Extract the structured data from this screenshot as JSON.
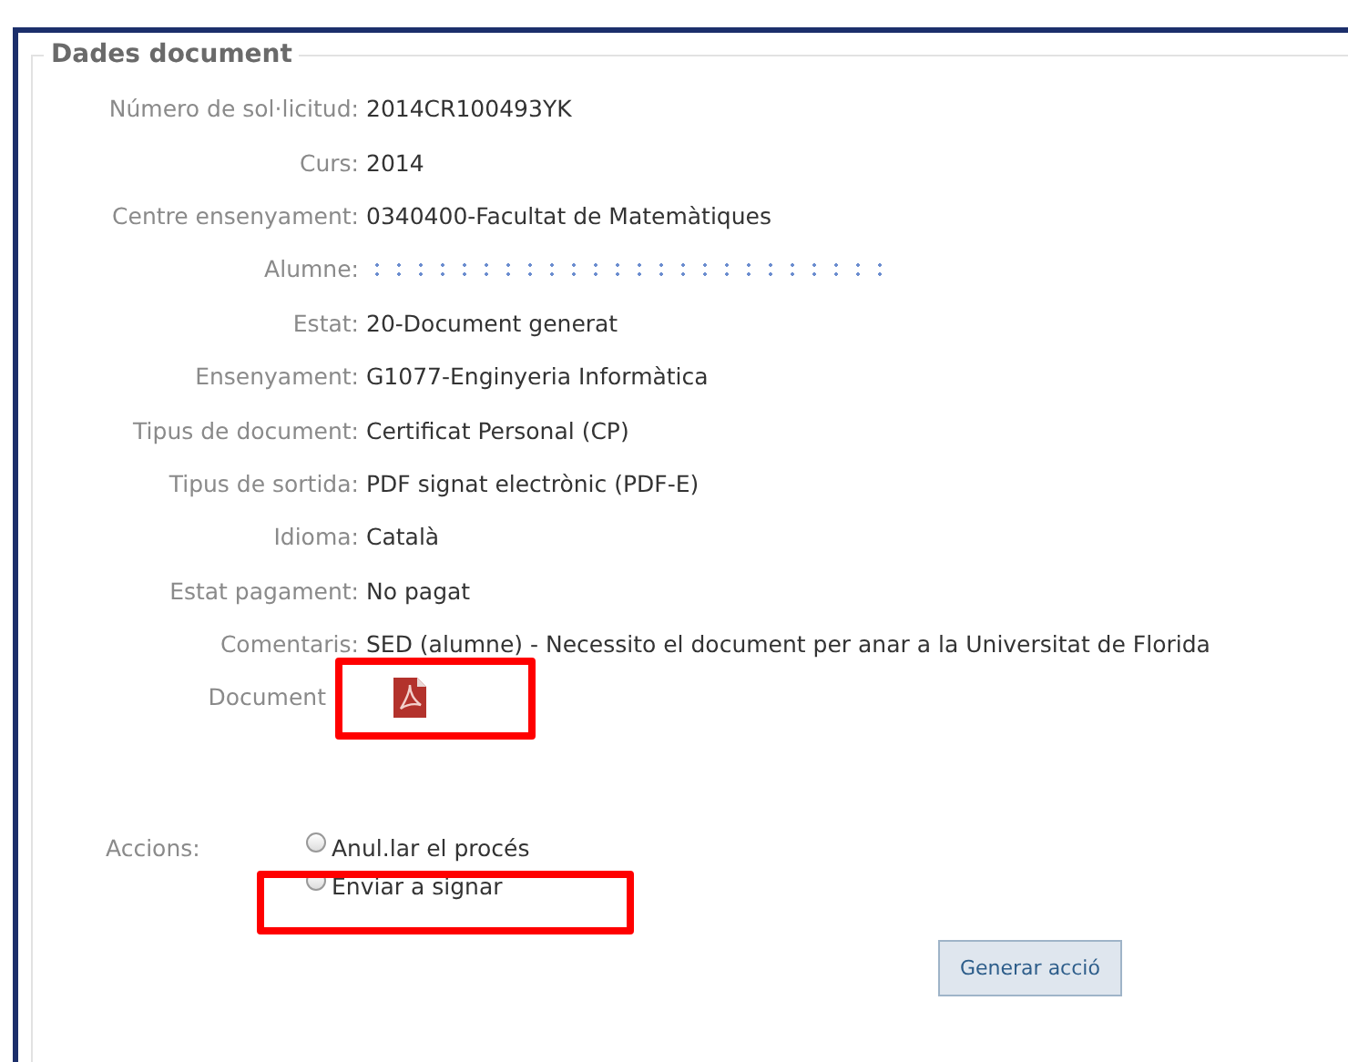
{
  "section": {
    "title": "Dades document"
  },
  "fields": [
    {
      "kind": "text",
      "label": "Número de sol·licitud:",
      "value": "2014CR100493YK"
    },
    {
      "kind": "text",
      "label": "Curs:",
      "value": "2014"
    },
    {
      "kind": "text",
      "label": "Centre ensenyament:",
      "value": "0340400-Facultat de Matemàtiques"
    },
    {
      "kind": "redacted",
      "label": "Alumne:"
    },
    {
      "kind": "text",
      "label": "Estat:",
      "value": "20-Document generat"
    },
    {
      "kind": "text",
      "label": "Ensenyament:",
      "value": "G1077-Enginyeria Informàtica"
    },
    {
      "kind": "text",
      "label": "Tipus de document:",
      "value": "Certificat Personal (CP)"
    },
    {
      "kind": "text",
      "label": "Tipus de sortida:",
      "value": "PDF signat electrònic (PDF-E)"
    },
    {
      "kind": "text",
      "label": "Idioma:",
      "value": "Català"
    },
    {
      "kind": "text",
      "label": "Estat pagament:",
      "value": "No pagat"
    },
    {
      "kind": "text",
      "label": "Comentaris:",
      "value": "SED (alumne) - Necessito el document per anar a la Universitat de Florida"
    },
    {
      "kind": "document",
      "label": "Document"
    }
  ],
  "actions": {
    "label": "Accions:",
    "options": [
      {
        "label": "Anul.lar el procés",
        "selected": false
      },
      {
        "label": "Enviar a signar",
        "selected": false
      }
    ]
  },
  "button": "Generar acció"
}
